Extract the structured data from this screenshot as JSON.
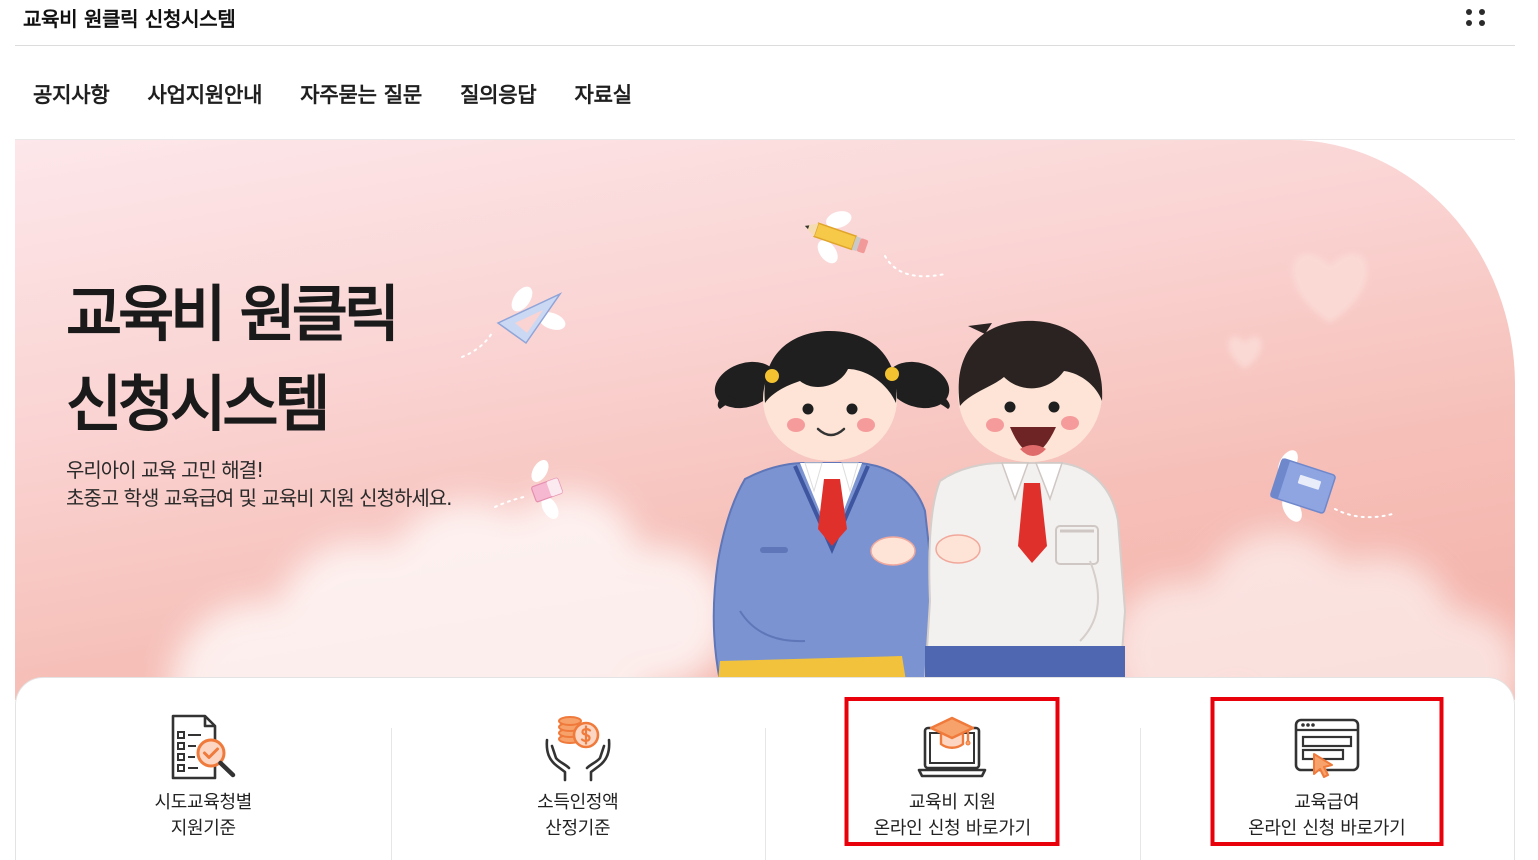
{
  "app": {
    "title": "교육비 원클릭 신청시스템",
    "menu_icon": "apps-grid-icon"
  },
  "nav": {
    "items": [
      {
        "label": "공지사항"
      },
      {
        "label": "사업지원안내"
      },
      {
        "label": "자주묻는 질문"
      },
      {
        "label": "질의응답"
      },
      {
        "label": "자료실"
      }
    ]
  },
  "hero": {
    "title_line1": "교육비 원클릭",
    "title_line2": "신청시스템",
    "subtitle_line1": "우리아이 교육 고민 해결!",
    "subtitle_line2": "초중고 학생 교육급여 및 교육비 지원 신청하세요."
  },
  "quick_links": [
    {
      "icon": "document-search-icon",
      "line1": "시도교육청별",
      "line2": "지원기준",
      "highlighted": false
    },
    {
      "icon": "coins-hands-icon",
      "line1": "소득인정액",
      "line2": "산정기준",
      "highlighted": false
    },
    {
      "icon": "laptop-graduation-cap-icon",
      "line1": "교육비 지원",
      "line2": "온라인 신청 바로가기",
      "highlighted": true
    },
    {
      "icon": "browser-cursor-icon",
      "line1": "교육급여",
      "line2": "온라인 신청 바로가기",
      "highlighted": true
    }
  ],
  "colors": {
    "hero_pink_light": "#fde7ea",
    "hero_pink": "#f3b0a7",
    "icon_accent": "#ef7a3b",
    "icon_accent_soft": "#f7a26a",
    "icon_accent_light": "#fcd6c2",
    "highlight_red": "#e8000b",
    "text": "#222222"
  }
}
